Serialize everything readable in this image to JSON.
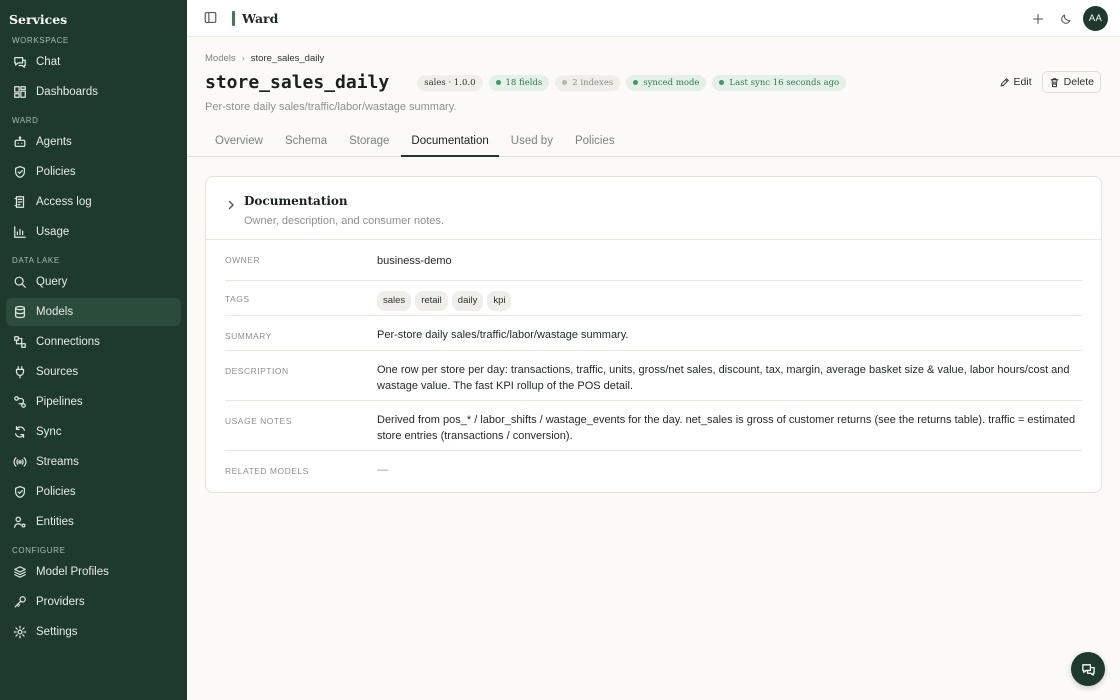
{
  "sidebar": {
    "brand": "Services",
    "sections": {
      "workspace": "WORKSPACE",
      "ward": "WARD",
      "data_lake": "DATA LAKE",
      "configure": "CONFIGURE"
    },
    "items": {
      "chat": "Chat",
      "dashboards": "Dashboards",
      "agents": "Agents",
      "policies": "Policies",
      "access_log": "Access log",
      "usage": "Usage",
      "query": "Query",
      "models": "Models",
      "connections": "Connections",
      "sources": "Sources",
      "pipelines": "Pipelines",
      "sync": "Sync",
      "streams": "Streams",
      "policies_lake": "Policies",
      "entities": "Entities",
      "model_profiles": "Model Profiles",
      "providers": "Providers",
      "settings": "Settings"
    },
    "active_item": "models"
  },
  "topbar": {
    "app_title": "Ward",
    "avatar_initials": "AA"
  },
  "header": {
    "breadcrumb": {
      "parent": "Models",
      "current": "store_sales_daily"
    },
    "title": "store_sales_daily",
    "badges": {
      "version": "sales · 1.0.0",
      "fields": "18 fields",
      "indexes": "2 indexes",
      "mode": "synced mode",
      "last_sync": "Last sync 16 seconds ago"
    },
    "subtitle": "Per-store daily sales/traffic/labor/wastage summary.",
    "edit_label": "Edit",
    "delete_label": "Delete",
    "tabs": [
      "Overview",
      "Schema",
      "Storage",
      "Documentation",
      "Used by",
      "Policies"
    ],
    "active_tab": "Documentation"
  },
  "documentation": {
    "title": "Documentation",
    "subtitle": "Owner, description, and consumer notes.",
    "owner_label": "OWNER",
    "owner": "business-demo",
    "tags_label": "TAGS",
    "tags": [
      "sales",
      "retail",
      "daily",
      "kpi"
    ],
    "summary_label": "SUMMARY",
    "summary": "Per-store daily sales/traffic/labor/wastage summary.",
    "description_label": "DESCRIPTION",
    "description": "One row per store per day: transactions, traffic, units, gross/net sales, discount, tax, margin, average basket size & value, labor hours/cost and wastage value. The fast KPI rollup of the POS detail.",
    "usage_notes_label": "USAGE NOTES",
    "usage_notes": "Derived from pos_* / labor_shifts / wastage_events for the day. net_sales is gross of customer returns (see the returns table). traffic = estimated store entries (transactions / conversion).",
    "related_models_label": "RELATED MODELS",
    "related_models": "—"
  },
  "colors": {
    "sidebar_bg": "#1e3a2c",
    "accent": "#3d7a58",
    "badge_green": "#2f7a4f"
  }
}
